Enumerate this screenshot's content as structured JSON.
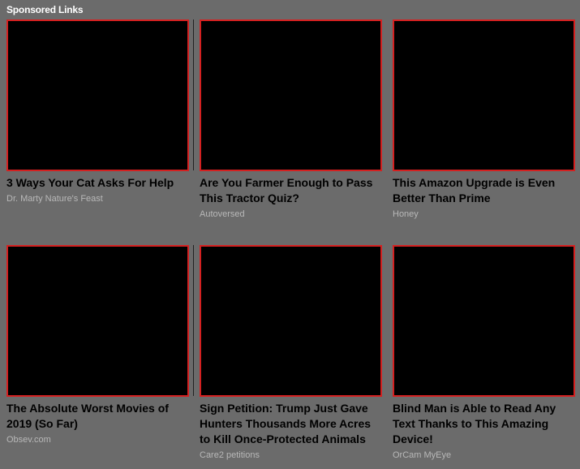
{
  "header": {
    "label": "Sponsored Links"
  },
  "colors": {
    "background": "#6b6b6b",
    "thumb_fill": "#000000",
    "thumb_border": "#d42020",
    "title": "#000000",
    "source": "#b8b8b8"
  },
  "cards": [
    {
      "title": "3 Ways Your Cat Asks For Help",
      "source": "Dr. Marty Nature's Feast"
    },
    {
      "title": "Are You Farmer Enough to Pass This Tractor Quiz?",
      "source": "Autoversed"
    },
    {
      "title": "This Amazon Upgrade is Even Better Than Prime",
      "source": "Honey"
    },
    {
      "title": "The Absolute Worst Movies of 2019 (So Far)",
      "source": "Obsev.com"
    },
    {
      "title": "Sign Petition: Trump Just Gave Hunters Thousands More Acres to Kill Once-Protected Animals",
      "source": "Care2 petitions"
    },
    {
      "title": "Blind Man is Able to Read Any Text Thanks to This Amazing Device!",
      "source": "OrCam MyEye"
    }
  ]
}
